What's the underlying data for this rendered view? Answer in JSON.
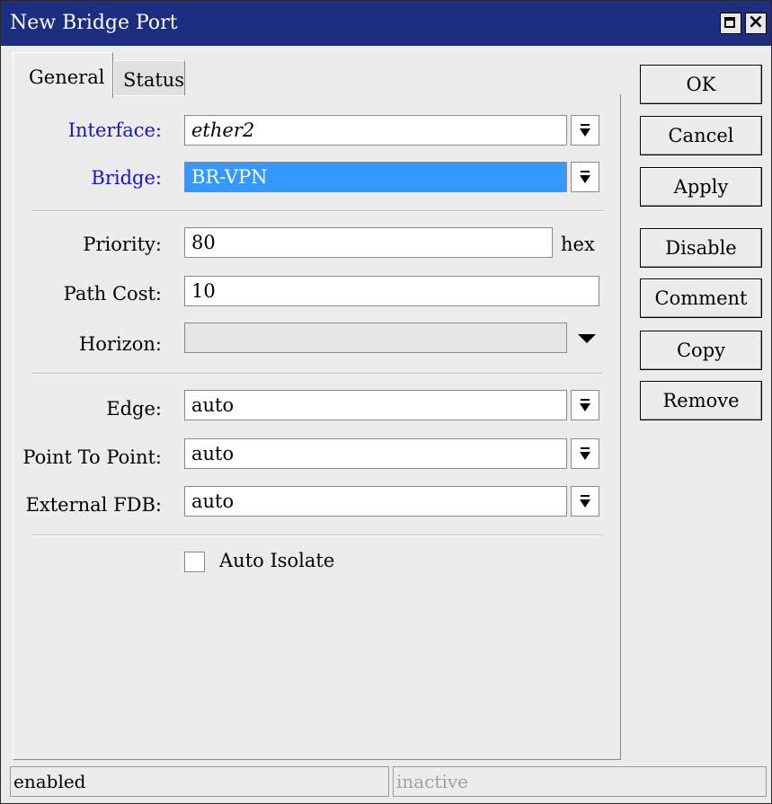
{
  "window": {
    "title": "New Bridge Port",
    "buttons": [
      "maximize-icon",
      "close-icon"
    ]
  },
  "tabs": [
    {
      "label": "General",
      "active": true
    },
    {
      "label": "Status",
      "active": false
    }
  ],
  "form": {
    "interface": {
      "label": "Interface:",
      "value": "ether2"
    },
    "bridge": {
      "label": "Bridge:",
      "value": "BR-VPN"
    },
    "priority": {
      "label": "Priority:",
      "value": "80",
      "suffix": "hex"
    },
    "path_cost": {
      "label": "Path Cost:",
      "value": "10"
    },
    "horizon": {
      "label": "Horizon:",
      "value": ""
    },
    "edge": {
      "label": "Edge:",
      "value": "auto"
    },
    "point_to_point": {
      "label": "Point To Point:",
      "value": "auto"
    },
    "external_fdb": {
      "label": "External FDB:",
      "value": "auto"
    },
    "auto_isolate": {
      "label": "Auto Isolate",
      "checked": false
    }
  },
  "actions": {
    "ok": "OK",
    "cancel": "Cancel",
    "apply": "Apply",
    "disable": "Disable",
    "comment": "Comment",
    "copy": "Copy",
    "remove": "Remove"
  },
  "statusbar": {
    "left": "enabled",
    "right": "inactive"
  },
  "colors": {
    "titlebar": "#1d2e80",
    "selection": "#3399ff",
    "link_label": "#1414d8"
  }
}
